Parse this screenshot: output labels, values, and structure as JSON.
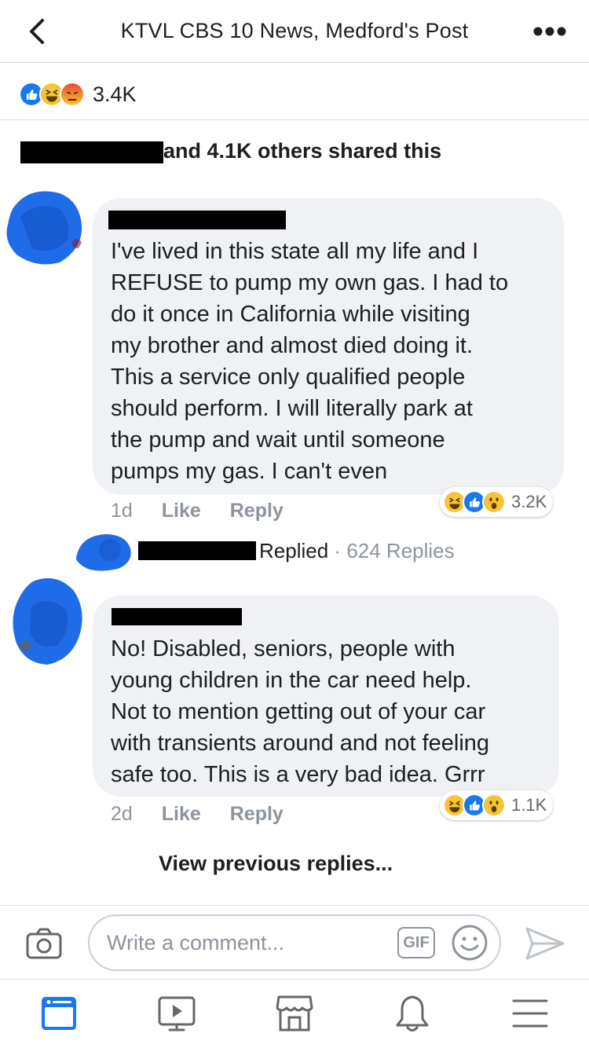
{
  "header": {
    "title": "KTVL CBS 10 News, Medford's Post"
  },
  "post_reactions": {
    "icons": [
      "like-icon",
      "haha-icon",
      "angry-icon"
    ],
    "count": "3.4K"
  },
  "shares": {
    "text": "and 4.1K others shared this"
  },
  "comments": [
    {
      "text": "I've lived in this state all my life and I REFUSE to pump my own gas. I had to do it once in California while visiting my brother and almost died doing it. This a service only qualified people should perform. I will literally park at the pump and wait until someone pumps my gas. I can't even",
      "lines": [
        "I've lived in this state all my life and I",
        "REFUSE to pump my own gas. I had to",
        "do it once in California while visiting",
        "my brother and almost died doing it.",
        "This a service only qualified people",
        "should perform. I will literally park at",
        "the pump and wait until someone",
        "pumps my gas. I can't even"
      ],
      "time": "1d",
      "like_label": "Like",
      "reply_label": "Reply",
      "reactions": {
        "icons": [
          "haha-icon",
          "like-icon",
          "wow-icon"
        ],
        "count": "3.2K"
      },
      "replied_label": "Replied",
      "reply_count": "624 Replies"
    },
    {
      "text": "No! Disabled, seniors, people with young children in the car need help. Not to mention getting out of your car with transients around and not feeling safe too. This is a very bad idea. Grrr",
      "lines": [
        "No! Disabled, seniors, people with",
        "young children in the car need help.",
        "Not to mention getting out of your car",
        "with transients around and not feeling",
        "safe too. This is a very bad idea. Grrr"
      ],
      "time": "2d",
      "like_label": "Like",
      "reply_label": "Reply",
      "reactions": {
        "icons": [
          "haha-icon",
          "like-icon",
          "wow-icon"
        ],
        "count": "1.1K"
      }
    }
  ],
  "view_previous": "View previous replies...",
  "composer": {
    "placeholder": "Write a comment...",
    "gif_label": "GIF"
  },
  "tabbar": {
    "items": [
      "news-feed-icon",
      "watch-icon",
      "marketplace-icon",
      "notifications-icon",
      "menu-icon"
    ]
  },
  "colors": {
    "like_blue": "#1877f2",
    "haha_yellow": "#f7c338",
    "angry_orange": "#f0652c",
    "avatar_scribble": "#1f6ce8"
  }
}
